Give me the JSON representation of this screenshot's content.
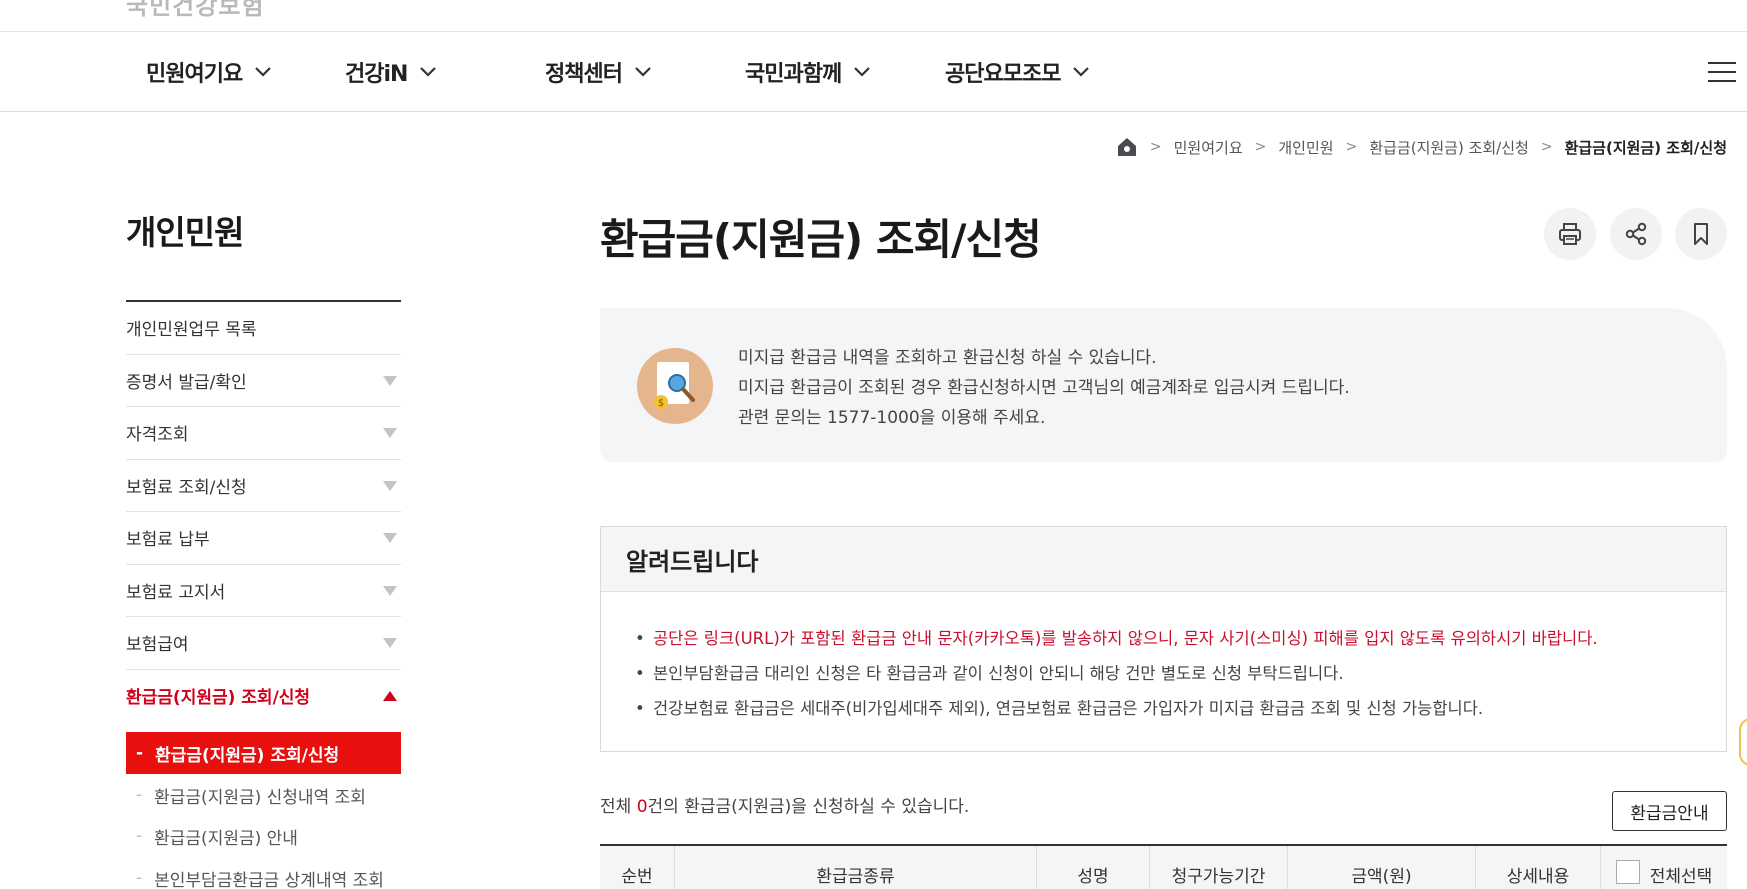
{
  "header": {
    "logo_text": "국민건강보험",
    "nav": [
      {
        "label": "민원여기요"
      },
      {
        "label": "건강iN"
      },
      {
        "label": "정책센터"
      },
      {
        "label": "국민과함께"
      },
      {
        "label": "공단요모조모"
      }
    ],
    "menu_icon": "hamburger-icon"
  },
  "breadcrumb": {
    "home_icon": "home-icon",
    "items": [
      "민원여기요",
      "개인민원",
      "환급금(지원금) 조회/신청",
      "환급금(지원금) 조회/신청"
    ]
  },
  "sidebar": {
    "title": "개인민원",
    "items": [
      {
        "label": "개인민원업무 목록"
      },
      {
        "label": "증명서 발급/확인"
      },
      {
        "label": "자격조회"
      },
      {
        "label": "보험료 조회/신청"
      },
      {
        "label": "보험료 납부"
      },
      {
        "label": "보험료 고지서"
      },
      {
        "label": "보험급여"
      },
      {
        "label": "환급금(지원금) 조회/신청"
      }
    ],
    "sub_items": [
      {
        "label": "환급금(지원금) 조회/신청"
      },
      {
        "label": "환급금(지원금) 신청내역 조회"
      },
      {
        "label": "환급금(지원금) 안내"
      },
      {
        "label": "본인부담금환급금 상계내역 조회"
      }
    ]
  },
  "main": {
    "title": "환급금(지원금) 조회/신청",
    "tools": [
      "print-icon",
      "share-icon",
      "bookmark-icon"
    ],
    "intro": {
      "icon": "refund-search-icon",
      "lines": [
        "미지급 환급금 내역을 조회하고 환급신청 하실 수 있습니다.",
        "미지급 환급금이 조회된 경우 환급신청하시면 고객님의 예금계좌로 입금시켜 드립니다.",
        "관련 문의는 1577-1000을 이용해 주세요."
      ]
    },
    "notice": {
      "title": "알려드립니다",
      "items": [
        "공단은 링크(URL)가 포함된 환급금 안내 문자(카카오톡)를 발송하지 않으니, 문자 사기(스미싱) 피해를 입지 않도록 유의하시기 바랍니다.",
        "본인부담환급금 대리인 신청은 타 환급금과 같이 신청이 안되니 해당 건만 별도로 신청 부탁드립니다.",
        "건강보험료 환급금은 세대주(비가입세대주 제외), 연금보험료 환급금은 가입자가 미지급 환급금 조회 및 신청 가능합니다."
      ]
    },
    "count": {
      "prefix": "전체 ",
      "number": "0",
      "suffix": "건의 환급금(지원금)을 신청하실 수 있습니다."
    },
    "guide_button": "환급금안내",
    "table": {
      "headers": [
        "순번",
        "환급금종류",
        "성명",
        "청구가능기간",
        "금액(원)",
        "상세내용",
        "전체선택"
      ]
    }
  },
  "colors": {
    "accent_red": "#e8100f",
    "alert_text": "#c8102e",
    "intro_bg": "#f4f5f7"
  }
}
